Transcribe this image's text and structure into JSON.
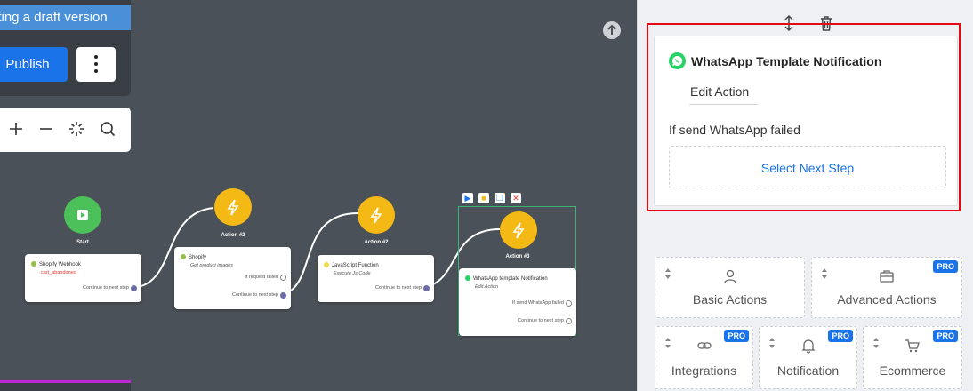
{
  "toolbar": {
    "draft_banner": "iting a draft version",
    "publish_label": "Publish"
  },
  "flow": {
    "start": {
      "caption": "Start",
      "card_title": "Shopify Webhook",
      "card_sub": "cart_abandoned",
      "row1": "Continue to next step"
    },
    "action2a": {
      "caption": "Action #2",
      "card_title": "Shopify",
      "card_sub": "Get product images",
      "row1": "If request failed",
      "row2": "Continue to next step"
    },
    "action2b": {
      "caption": "Action #2",
      "card_title": "JavaScript Function",
      "card_sub": "Execute Js Code",
      "row1": "Continue to next step"
    },
    "action3": {
      "caption": "Action #3",
      "card_title": "WhatsApp template Notification",
      "card_sub": "Edit Action",
      "row1": "If send WhatsApp failed",
      "row2": "Continue to next step"
    }
  },
  "panel": {
    "title": "WhatsApp Template Notification",
    "edit_action": "Edit Action",
    "fail_label": "If send WhatsApp failed",
    "next_step": "Select Next Step",
    "categories": [
      {
        "label": "Basic Actions",
        "pro": ""
      },
      {
        "label": "Advanced Actions",
        "pro": "PRO"
      },
      {
        "label": "Integrations",
        "pro": "PRO"
      },
      {
        "label": "Notification",
        "pro": "PRO"
      },
      {
        "label": "Ecommerce",
        "pro": "PRO"
      }
    ]
  },
  "colors": {
    "accent": "#1a73e8",
    "canvas": "#4b5158",
    "start": "#4cc159",
    "action": "#f5b915",
    "whatsapp": "#25d366",
    "highlight": "#e50914"
  }
}
